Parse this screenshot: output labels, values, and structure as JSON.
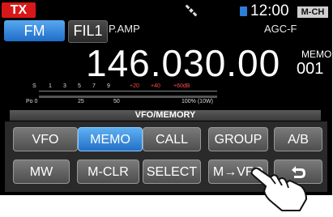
{
  "status": {
    "tx": "TX",
    "time": "12:00",
    "channel_mode": "M-CH"
  },
  "mode": {
    "mode_button": "FM",
    "filter_button": "FIL1",
    "preamp": "P.AMP",
    "agc": "AGC-F"
  },
  "frequency": "146.030.00",
  "memo": {
    "label": "MEMO",
    "channel": "001"
  },
  "meter": {
    "s_labels": [
      "S",
      "1",
      "3",
      "5",
      "7",
      "9",
      "+20",
      "+40",
      "+60dB"
    ],
    "po_labels": [
      "Po 0",
      "25",
      "50",
      "100% (10W)"
    ]
  },
  "panel_title": "VFO/MEMORY",
  "buttons": {
    "vfo": "VFO",
    "memo": "MEMO",
    "call": "CALL",
    "group": "GROUP",
    "ab": "A/B",
    "mw": "MW",
    "mclr": "M-CLR",
    "select": "SELECT",
    "mvfo": "M→VFO"
  },
  "icons": {
    "back": "back-arrow-icon",
    "satellite": "satellite-icon",
    "sd": "sd-card-icon",
    "hand": "pointing-hand-icon"
  },
  "colors": {
    "active": "#2f84d8",
    "tx": "#d81818"
  }
}
